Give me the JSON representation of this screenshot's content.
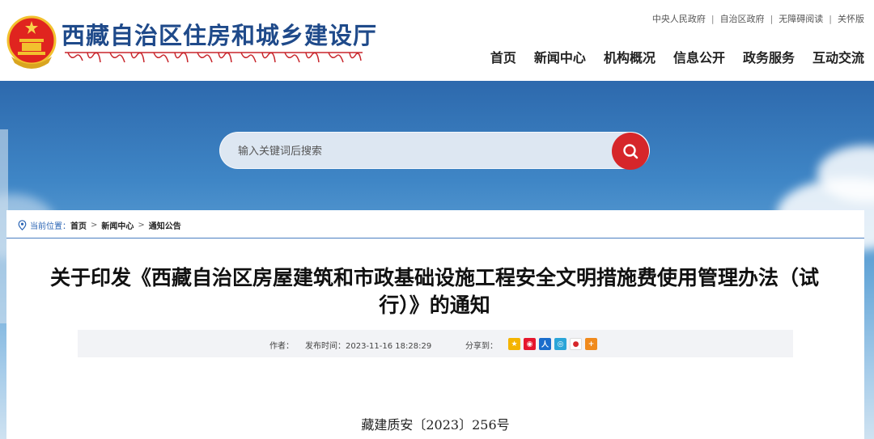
{
  "header": {
    "site_name": "西藏自治区住房和城乡建设厅",
    "top_links": [
      "中央人民政府",
      "自治区政府",
      "无障碍阅读",
      "关怀版"
    ],
    "nav": [
      "首页",
      "新闻中心",
      "机构概况",
      "信息公开",
      "政务服务",
      "互动交流"
    ],
    "icons": {
      "emblem": "national-emblem-icon"
    }
  },
  "search": {
    "placeholder": "输入关键词后搜索",
    "button_icon": "search-icon"
  },
  "breadcrumb": {
    "label": "当前位置：",
    "items": [
      "首页",
      "新闻中心",
      "通知公告"
    ],
    "separator": ">"
  },
  "article": {
    "title_line1": "关于印发《西藏自治区房屋建筑和市政基础设施工程安全文明措施费使用管理办法（试",
    "title_line2": "行）》的通知",
    "author_label": "作者：",
    "published_label": "发布时间：2023-11-16 18:28:29",
    "share_label": "分享到：",
    "share_icons": [
      "qzone-icon",
      "weibo-icon",
      "renren-icon",
      "tencent-weibo-icon",
      "douban-icon",
      "more-share-icon"
    ],
    "doc_number": "藏建质安〔2023〕256号"
  },
  "colors": {
    "brand_blue": "#1f4a8a",
    "search_red": "#d6262a",
    "divider_blue": "#4a7fc1"
  }
}
